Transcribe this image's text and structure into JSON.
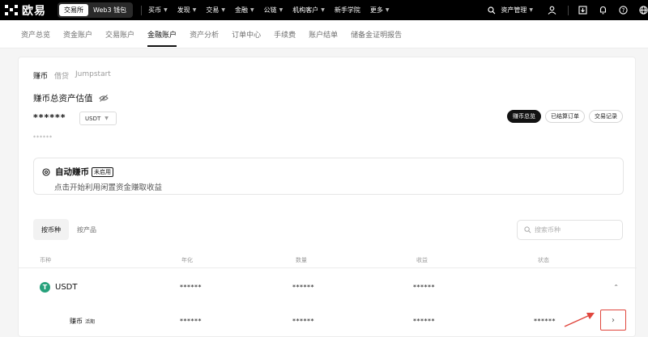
{
  "brand": {
    "name": "欧易"
  },
  "mode_toggle": {
    "exchange": "交易所",
    "web3": "Web3 钱包"
  },
  "top_nav": [
    {
      "label": "买币"
    },
    {
      "label": "发现"
    },
    {
      "label": "交易"
    },
    {
      "label": "金融"
    },
    {
      "label": "公链"
    },
    {
      "label": "机构客户"
    },
    {
      "label": "新手学院"
    },
    {
      "label": "更多"
    }
  ],
  "top_right": {
    "asset_label": "资产管理"
  },
  "sub_nav": [
    {
      "label": "资产总览"
    },
    {
      "label": "资金账户"
    },
    {
      "label": "交易账户"
    },
    {
      "label": "金融账户",
      "active": true
    },
    {
      "label": "资产分析"
    },
    {
      "label": "订单中心"
    },
    {
      "label": "手续费"
    },
    {
      "label": "账户结单"
    },
    {
      "label": "储备金证明报告"
    }
  ],
  "card": {
    "tabs": [
      {
        "label": "赚币",
        "active": true
      },
      {
        "label": "借贷"
      },
      {
        "label": "Jumpstart"
      }
    ],
    "estimate_title": "赚币总资产估值",
    "masked_total": "******",
    "currency": "USDT",
    "masked_sub": "******",
    "right_buttons": [
      {
        "label": "赚币总览",
        "active": true
      },
      {
        "label": "已结算订单"
      },
      {
        "label": "交易记录"
      }
    ],
    "auto_earn": {
      "title": "自动赚币",
      "badge": "未启用",
      "desc": "点击开始利用闲置资金赚取收益"
    },
    "segments": [
      {
        "label": "按币种",
        "active": true
      },
      {
        "label": "按产品"
      }
    ],
    "search_placeholder": "搜索币种",
    "columns": [
      "币种",
      "年化",
      "数量",
      "收益",
      "状态"
    ],
    "rows": [
      {
        "coin": "USDT",
        "apy": "******",
        "amount": "******",
        "earnings": "******"
      },
      {
        "product": "赚币",
        "tag": "活期",
        "apy": "******",
        "amount": "******",
        "earnings": "******",
        "status": "******"
      }
    ]
  },
  "colors": {
    "topbar": "#000000",
    "highlight": "#e0463d",
    "usdt": "#26a17b"
  }
}
